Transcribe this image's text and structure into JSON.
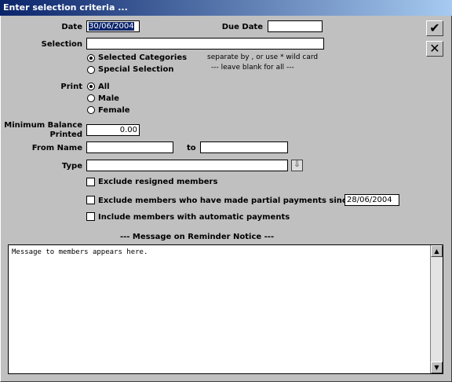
{
  "window": {
    "title": "Enter selection criteria ..."
  },
  "toolbar": {
    "ok_icon": "checkmark-icon",
    "cancel_icon": "close-icon"
  },
  "form": {
    "date_label": "Date",
    "date_value": "30/06/2004",
    "due_date_label": "Due Date",
    "due_date_value": "",
    "selection_label": "Selection",
    "selection_value": "",
    "selection_options": [
      {
        "label": "Selected Categories",
        "selected": true
      },
      {
        "label": "Special Selection",
        "selected": false
      }
    ],
    "selection_note_1": "separate by , or use * wild card",
    "selection_note_2": "---  leave blank for all  ---",
    "print_label": "Print",
    "print_options": [
      {
        "label": "All",
        "selected": true
      },
      {
        "label": "Male",
        "selected": false
      },
      {
        "label": "Female",
        "selected": false
      }
    ],
    "min_balance_label_1": "Minimum Balance",
    "min_balance_label_2": "Printed",
    "min_balance_value": "0.00",
    "from_name_label": "From Name",
    "from_name_value": "",
    "to_label": "to",
    "to_value": "",
    "type_label": "Type",
    "type_value": "",
    "exclude_resigned_label": "Exclude resigned members",
    "exclude_resigned_checked": false,
    "exclude_partial_label": "Exclude members who have made partial payments since",
    "exclude_partial_checked": false,
    "partial_since_value": "28/06/2004",
    "include_auto_label": "Include members with automatic payments",
    "include_auto_checked": false
  },
  "message": {
    "heading": "---  Message on Reminder Notice  ---",
    "text": "Message to members appears here."
  }
}
